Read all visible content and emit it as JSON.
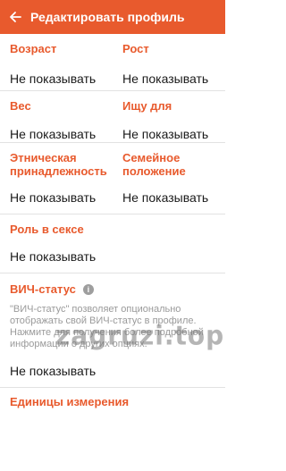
{
  "app_bar": {
    "title": "Редактировать профиль",
    "back_icon": "arrow-left-icon"
  },
  "fields": {
    "age": {
      "label": "Возраст",
      "value": "Не показывать"
    },
    "height": {
      "label": "Рост",
      "value": "Не показывать"
    },
    "weight": {
      "label": "Вес",
      "value": "Не показывать"
    },
    "looking_for": {
      "label": "Ищу для",
      "value": "Не показывать"
    },
    "ethnicity": {
      "label": "Этническая принадлежность",
      "value": "Не показывать"
    },
    "relationship": {
      "label": "Семейное положение",
      "value": "Не показывать"
    },
    "role": {
      "label": "Роль в сексе",
      "value": "Не показывать"
    }
  },
  "hiv": {
    "label": "ВИЧ-статус",
    "info_icon": "info-icon",
    "info_glyph": "i",
    "description": "\"ВИЧ-статус\" позволяет опционально отображать свой ВИЧ-статус в профиле. Нажмите для получения более подробной информации о других опциях.",
    "value": "Не показывать",
    "watermark": "zagruzi.top"
  },
  "units": {
    "label": "Единицы измерения"
  },
  "colors": {
    "accent": "#e85a2d",
    "divider": "#e2e2e2"
  }
}
